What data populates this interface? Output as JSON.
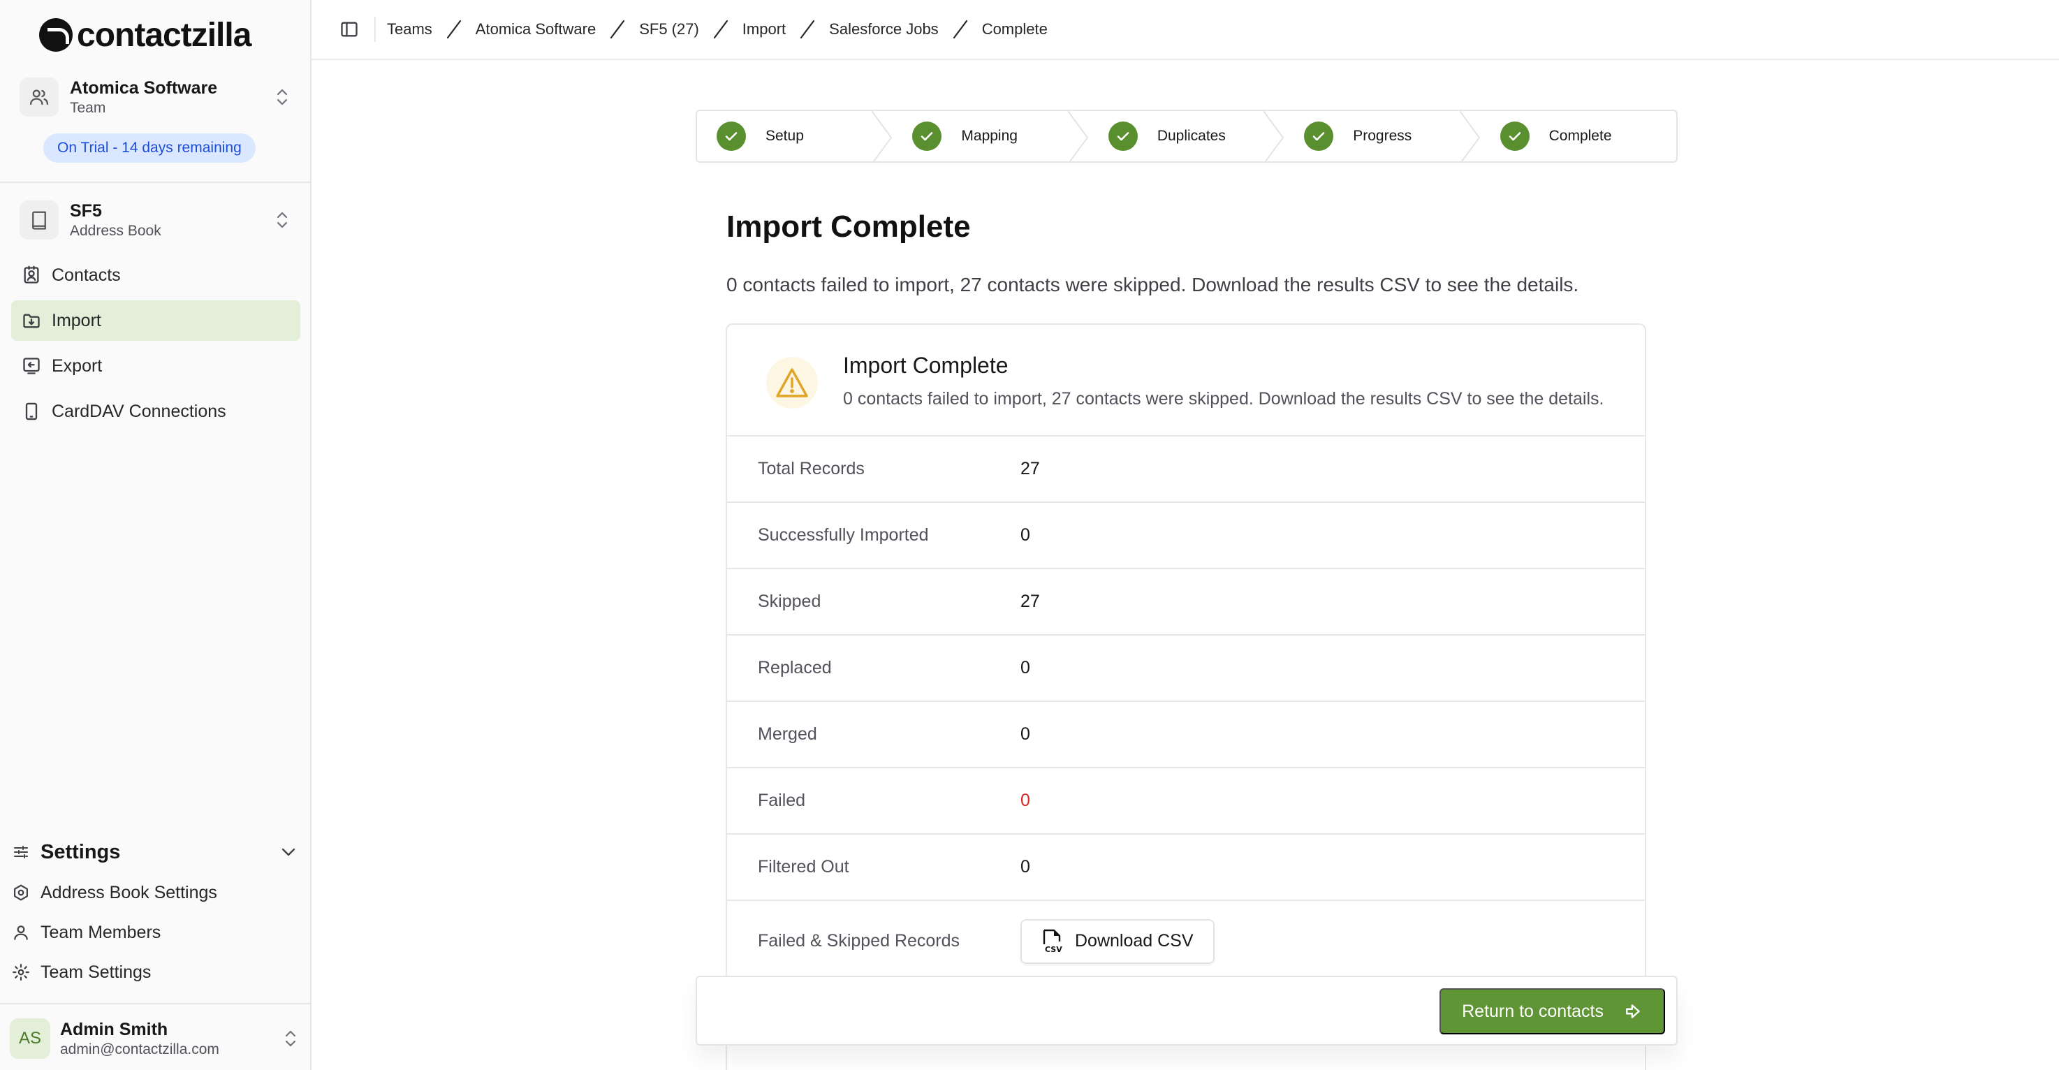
{
  "app": {
    "logo_text": "contactzilla"
  },
  "team_switcher": {
    "name": "Atomica Software",
    "subtitle": "Team"
  },
  "trial_badge": "On Trial - 14 days remaining",
  "book_switcher": {
    "name": "SF5",
    "subtitle": "Address Book"
  },
  "nav": {
    "contacts": "Contacts",
    "import": "Import",
    "export": "Export",
    "carddav": "CardDAV Connections"
  },
  "settings": {
    "heading": "Settings",
    "address_book_settings": "Address Book Settings",
    "team_members": "Team Members",
    "team_settings": "Team Settings"
  },
  "user": {
    "initials": "AS",
    "name": "Admin Smith",
    "email": "admin@contactzilla.com"
  },
  "breadcrumbs": [
    "Teams",
    "Atomica Software",
    "SF5 (27)",
    "Import",
    "Salesforce Jobs",
    "Complete"
  ],
  "steps": [
    {
      "label": "Setup",
      "status": "complete"
    },
    {
      "label": "Mapping",
      "status": "complete"
    },
    {
      "label": "Duplicates",
      "status": "complete"
    },
    {
      "label": "Progress",
      "status": "complete"
    },
    {
      "label": "Complete",
      "status": "complete"
    }
  ],
  "page": {
    "title": "Import Complete",
    "description": "0 contacts failed to import, 27 contacts were skipped. Download the results CSV to see the details."
  },
  "alert": {
    "title": "Import Complete",
    "message": "0 contacts failed to import, 27 contacts were skipped. Download the results CSV to see the details."
  },
  "stats": [
    {
      "label": "Total Records",
      "value": "27"
    },
    {
      "label": "Successfully Imported",
      "value": "0"
    },
    {
      "label": "Skipped",
      "value": "27"
    },
    {
      "label": "Replaced",
      "value": "0"
    },
    {
      "label": "Merged",
      "value": "0"
    },
    {
      "label": "Failed",
      "value": "0"
    },
    {
      "label": "Filtered Out",
      "value": "0"
    }
  ],
  "records_row": {
    "label": "Failed & Skipped Records",
    "button_label": "Download CSV"
  },
  "footer": {
    "return_label": "Return to contacts"
  },
  "colors": {
    "accent": "#5f9535",
    "step_check": "#5a8f30",
    "nav_active_bg": "#e3efd9",
    "trial_bg": "#dbe7ff",
    "trial_text": "#1d4ed8",
    "danger": "#dc2626",
    "warning": "#e0a526"
  }
}
